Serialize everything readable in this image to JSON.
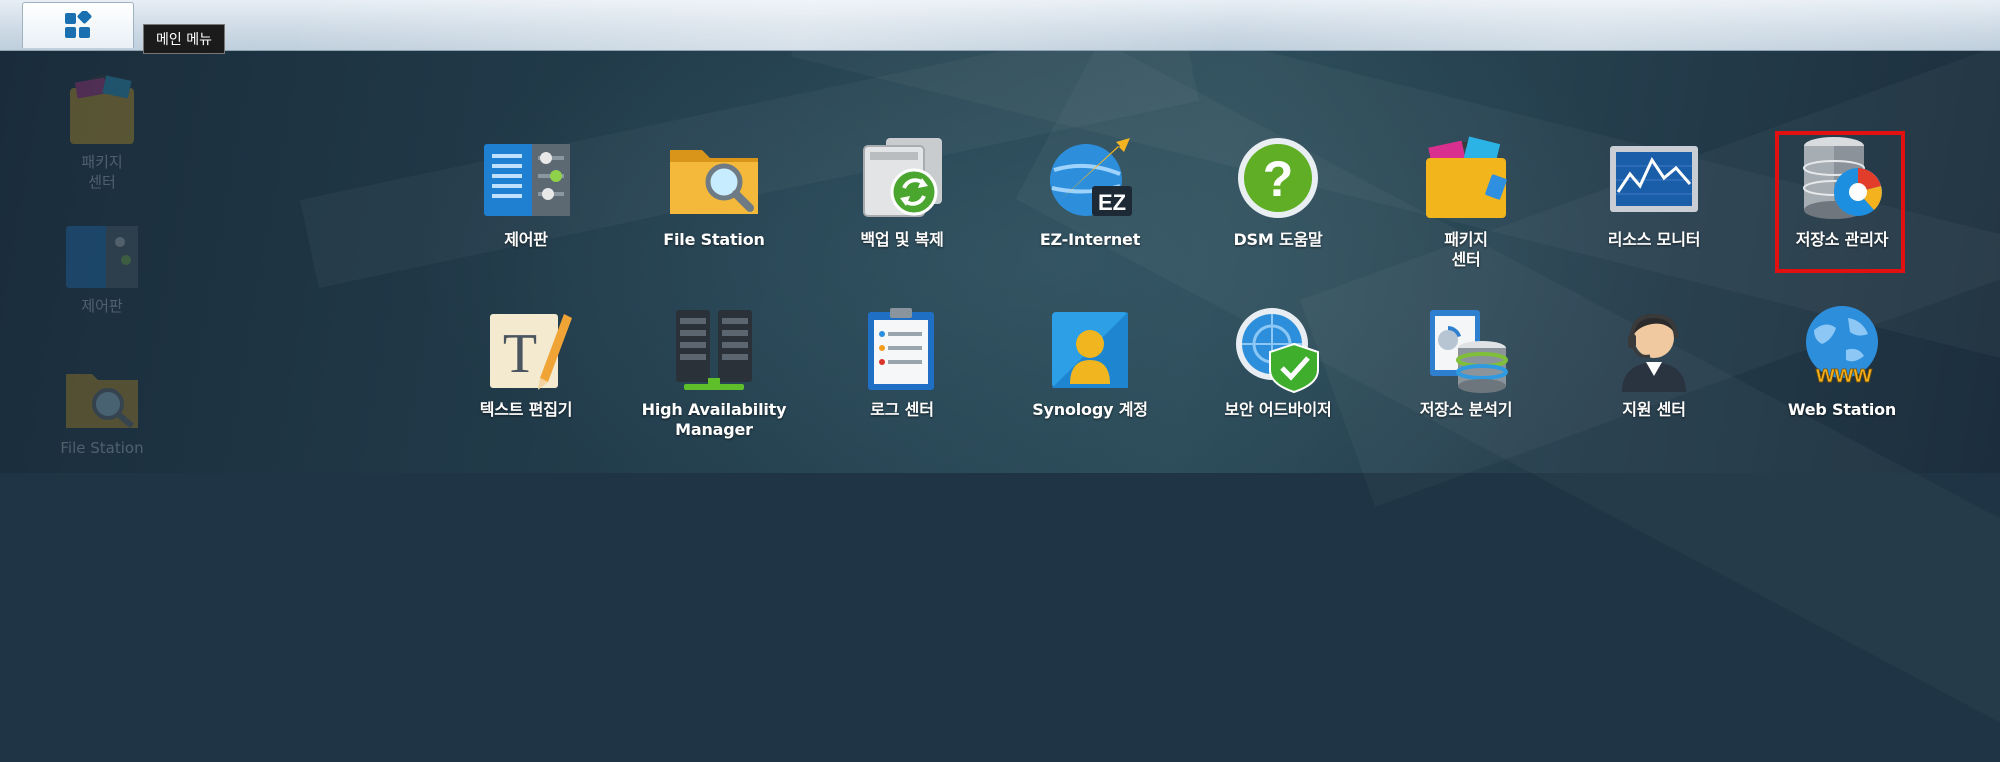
{
  "taskbar": {
    "main_menu_icon": "grid-apps-icon",
    "tooltip": "메인 메뉴"
  },
  "desktop": {
    "shortcuts": [
      {
        "label": "패키지\n센터",
        "icon": "package-center-icon"
      },
      {
        "label": "제어판",
        "icon": "control-panel-icon"
      },
      {
        "label": "File Station",
        "icon": "folder-search-icon"
      }
    ]
  },
  "main_menu": {
    "rows": [
      [
        {
          "label": "제어판",
          "icon": "control-panel-icon"
        },
        {
          "label": "File Station",
          "icon": "folder-search-icon"
        },
        {
          "label": "백업 및 복제",
          "icon": "backup-replication-icon"
        },
        {
          "label": "EZ-Internet",
          "icon": "ez-internet-icon"
        },
        {
          "label": "DSM 도움말",
          "icon": "help-icon"
        },
        {
          "label": "패키지\n센터",
          "icon": "package-center-icon"
        },
        {
          "label": "리소스 모니터",
          "icon": "resource-monitor-icon"
        },
        {
          "label": "저장소 관리자",
          "icon": "storage-manager-icon",
          "highlighted": true
        }
      ],
      [
        {
          "label": "텍스트 편집기",
          "icon": "text-editor-icon"
        },
        {
          "label": "High Availability\nManager",
          "icon": "high-availability-icon"
        },
        {
          "label": "로그 센터",
          "icon": "log-center-icon"
        },
        {
          "label": "Synology 계정",
          "icon": "synology-account-icon"
        },
        {
          "label": "보안 어드바이저",
          "icon": "security-advisor-icon"
        },
        {
          "label": "저장소 분석기",
          "icon": "storage-analyzer-icon"
        },
        {
          "label": "지원 센터",
          "icon": "support-center-icon"
        },
        {
          "label": "Web Station",
          "icon": "web-station-icon"
        }
      ]
    ]
  },
  "colors": {
    "highlight": "#e21010",
    "desktop_bg": "#1f3444",
    "label": "#ffffff"
  }
}
